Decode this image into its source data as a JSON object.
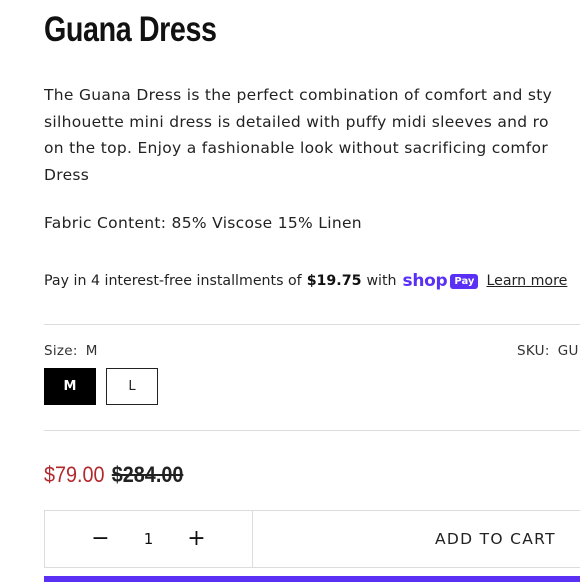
{
  "product": {
    "title": "Guana Dress",
    "description": [
      "The Guana Dress is the perfect combination of comfort and sty",
      "silhouette mini dress is detailed with puffy midi sleeves and ro",
      "on the top. Enjoy a fashionable look without sacrificing comfor",
      "Dress"
    ],
    "fabric": "Fabric Content: 85% Viscose 15% Linen"
  },
  "installments": {
    "prefix": "Pay in 4 interest-free installments of",
    "amount": "$19.75",
    "with": "with",
    "shop_text": "shop",
    "pay_badge": "Pay",
    "learn_more": "Learn more"
  },
  "variant": {
    "size_label": "Size:",
    "size_value": "M",
    "sku_label": "SKU:",
    "sku_value": "GU",
    "options": [
      "M",
      "L"
    ],
    "selected": "M"
  },
  "pricing": {
    "sale_price": "$79.00",
    "compare_price": "$284.00",
    "sale_color": "#b3282d"
  },
  "cart": {
    "quantity": "1",
    "minus": "−",
    "plus": "+",
    "add_label": "ADD TO CART"
  },
  "colors": {
    "shop_pay": "#5a31f4"
  }
}
